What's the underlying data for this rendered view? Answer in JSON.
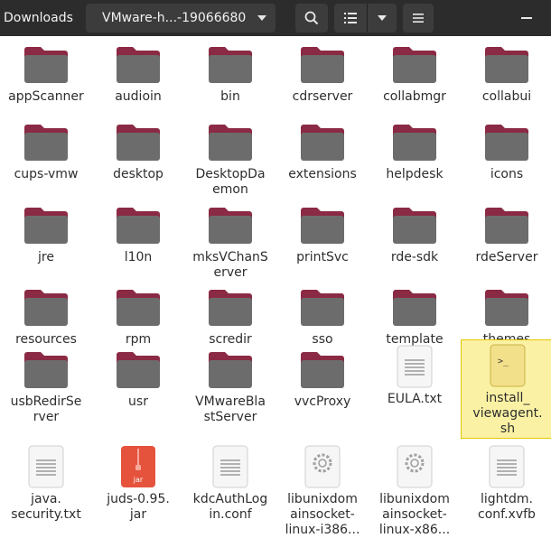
{
  "header": {
    "breadcrumb_parent": "Downloads",
    "breadcrumb_current": "VMware-h...-19066680",
    "search_icon": "search-icon",
    "view_list_icon": "list-view-icon",
    "view_dropdown_icon": "chevron-down-icon",
    "menu_icon": "hamburger-menu-icon"
  },
  "colors": {
    "header_bg": "#2c2c2c",
    "folder_tab": "#8b2a44",
    "folder_body": "#6c6c6c",
    "selection_bg": "#fbf1a4",
    "selection_border": "#e2c900"
  },
  "files": [
    {
      "name": "appScanner",
      "type": "folder"
    },
    {
      "name": "audioin",
      "type": "folder"
    },
    {
      "name": "bin",
      "type": "folder"
    },
    {
      "name": "cdrserver",
      "type": "folder"
    },
    {
      "name": "collabmgr",
      "type": "folder"
    },
    {
      "name": "collabui",
      "type": "folder"
    },
    {
      "name": "cups-vmw",
      "type": "folder"
    },
    {
      "name": "desktop",
      "type": "folder"
    },
    {
      "name": "DesktopDa\nemon",
      "type": "folder"
    },
    {
      "name": "extensions",
      "type": "folder"
    },
    {
      "name": "helpdesk",
      "type": "folder"
    },
    {
      "name": "icons",
      "type": "folder"
    },
    {
      "name": "jre",
      "type": "folder"
    },
    {
      "name": "l10n",
      "type": "folder"
    },
    {
      "name": "mksVChanS\nerver",
      "type": "folder"
    },
    {
      "name": "printSvc",
      "type": "folder"
    },
    {
      "name": "rde-sdk",
      "type": "folder"
    },
    {
      "name": "rdeServer",
      "type": "folder"
    },
    {
      "name": "resources",
      "type": "folder"
    },
    {
      "name": "rpm",
      "type": "folder"
    },
    {
      "name": "scredir",
      "type": "folder"
    },
    {
      "name": "sso",
      "type": "folder"
    },
    {
      "name": "template",
      "type": "folder"
    },
    {
      "name": "themes",
      "type": "folder"
    },
    {
      "name": "usbRedirSe\nrver",
      "type": "folder"
    },
    {
      "name": "usr",
      "type": "folder"
    },
    {
      "name": "VMwareBla\nstServer",
      "type": "folder"
    },
    {
      "name": "vvcProxy",
      "type": "folder"
    },
    {
      "name": "EULA.txt",
      "type": "text"
    },
    {
      "name": "install_\nviewagent.\nsh",
      "type": "script",
      "selected": true
    },
    {
      "name": "java.\nsecurity.txt",
      "type": "text"
    },
    {
      "name": "juds-0.95.\njar",
      "type": "jar",
      "badge": "jar"
    },
    {
      "name": "kdcAuthLog\nin.conf",
      "type": "text"
    },
    {
      "name": "libunixdom\nainsocket-\nlinux-i386...",
      "type": "library"
    },
    {
      "name": "libunixdom\nainsocket-\nlinux-x86...",
      "type": "library"
    },
    {
      "name": "lightdm.\nconf.xvfb",
      "type": "text"
    }
  ]
}
